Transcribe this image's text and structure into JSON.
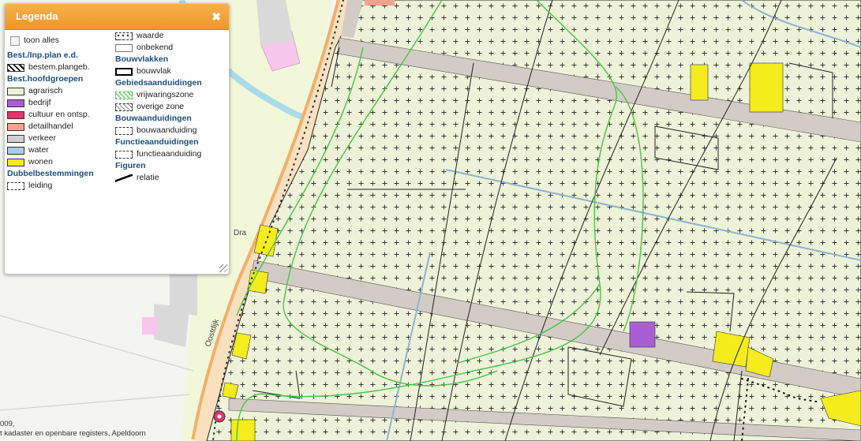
{
  "legend": {
    "title": "Legenda",
    "close_icon": "close-x-icon",
    "toon_alles": "toon alles",
    "groups_left": [
      {
        "heading": "Best./Inp.plan e.d.",
        "items": [
          {
            "label": "bestem.plangeb.",
            "swatch": "hatch-black"
          }
        ]
      },
      {
        "heading": "Best.hoofdgroepen",
        "items": [
          {
            "label": "agrarisch",
            "color": "#eef2d8"
          },
          {
            "label": "bedrijf",
            "color": "#a95fd3"
          },
          {
            "label": "cultuur en ontsp.",
            "color": "#e8346e"
          },
          {
            "label": "detailhandel",
            "color": "#f5a28c"
          },
          {
            "label": "verkeer",
            "color": "#cfcfcf"
          },
          {
            "label": "water",
            "color": "#a9cde8"
          },
          {
            "label": "wonen",
            "color": "#f4ec1c"
          }
        ]
      },
      {
        "heading": "Dubbelbestemmingen",
        "items": [
          {
            "label": "leiding",
            "swatch": "dots"
          }
        ]
      }
    ],
    "groups_right": [
      {
        "heading": "",
        "items": [
          {
            "label": "waarde",
            "swatch": "dots-dashed"
          },
          {
            "label": "onbekend",
            "swatch": "empty"
          }
        ]
      },
      {
        "heading": "Bouwvlakken",
        "items": [
          {
            "label": "bouwvlak",
            "swatch": "thick-border"
          }
        ]
      },
      {
        "heading": "Gebiedsaanduidingen",
        "items": [
          {
            "label": "vrijwaringszone",
            "swatch": "green-hatch"
          },
          {
            "label": "overige zone",
            "swatch": "grey-hatch"
          }
        ]
      },
      {
        "heading": "Bouwaanduidingen",
        "items": [
          {
            "label": "bouwaanduiding",
            "swatch": "dashed"
          }
        ]
      },
      {
        "heading": "Functieaanduidingen",
        "items": [
          {
            "label": "functieaanduiding",
            "swatch": "dashed"
          }
        ]
      },
      {
        "heading": "Figuren",
        "items": [
          {
            "label": "relatie",
            "swatch": "relation-line"
          }
        ]
      }
    ]
  },
  "map": {
    "street_oostdijk": "Oostdijk",
    "street_dra": "Dra",
    "copyright": "009,\nt kadaster en openbare registers, Apeldoorn",
    "colors": {
      "agrarisch": "#eef2d8",
      "verkeer": "#d3ccc6",
      "wonen": "#f4ec1c",
      "bedrijf": "#a95fd3",
      "water": "#a9cde8",
      "zone": "#47c447",
      "cultuur": "#e8346e"
    }
  }
}
